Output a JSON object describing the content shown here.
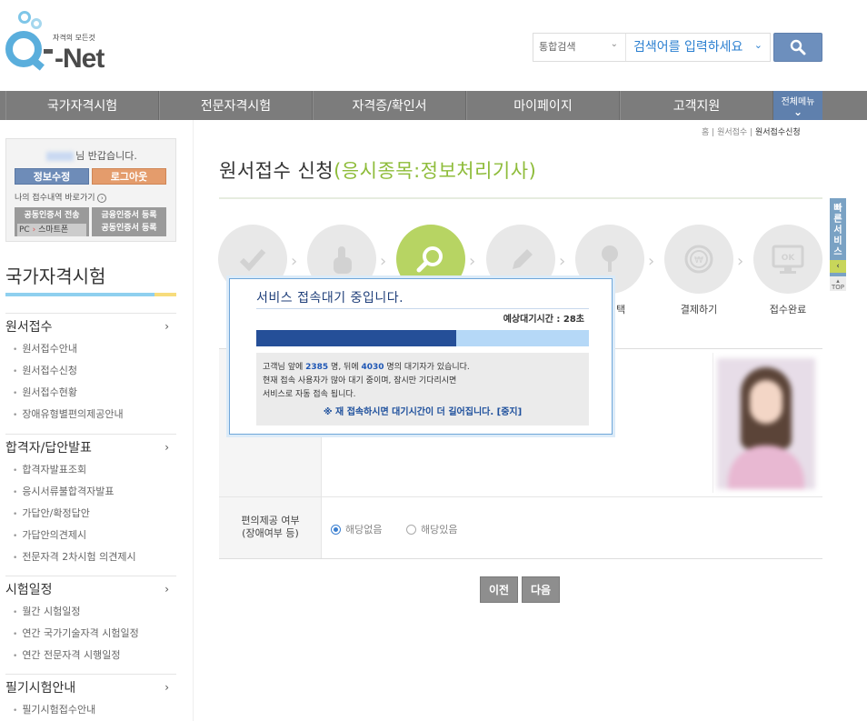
{
  "header": {
    "logo_text": "-Net",
    "logo_tagline": "자격의 모든것",
    "search_category": "통합검색",
    "search_placeholder": "검색어를 입력하세요"
  },
  "nav": {
    "items": [
      "국가자격시험",
      "전문자격시험",
      "자격증/확인서",
      "마이페이지",
      "고객지원"
    ],
    "all_menu": "전체메뉴"
  },
  "login": {
    "greeting": "님 반갑습니다.",
    "edit_label": "정보수정",
    "logout_label": "로그아웃",
    "history_link": "나의 접수내역 바로가기",
    "cert_send_line1": "공동인증서 전송",
    "cert_send_line2": "PC",
    "cert_send_line3": "스마트폰",
    "cert_reg_line1": "금융인증서 등록",
    "cert_reg_line2": "공동인증서 등록"
  },
  "sidebar": {
    "section_title": "국가자격시험",
    "groups": [
      {
        "title": "원서접수",
        "items": [
          "원서접수안내",
          "원서접수신청",
          "원서접수현황",
          "장애유형별편의제공안내"
        ]
      },
      {
        "title": "합격자/답안발표",
        "items": [
          "합격자발표조회",
          "응시서류불합격자발표",
          "가답안/확정답안",
          "가답안의견제시",
          "전문자격 2차시험 의견제시"
        ]
      },
      {
        "title": "시험일정",
        "items": [
          "월간 시험일정",
          "연간 국가기술자격 시험일정",
          "연간 전문자격 시행일정"
        ]
      },
      {
        "title": "필기시험안내",
        "items": [
          "필기시험접수안내"
        ]
      }
    ]
  },
  "breadcrumb": {
    "home": "홈",
    "level1": "원서접수",
    "current": "원서접수신청",
    "sep": "|"
  },
  "page": {
    "title": "원서접수 신청",
    "subject": "(응시종목:정보처리기사)"
  },
  "steps": {
    "labels": [
      "선택",
      "결제하기",
      "접수완료"
    ]
  },
  "form": {
    "option_label_line1": "편의제공 여부",
    "option_label_line2": "(장애여부 등)",
    "radio_no": "해당없음",
    "radio_yes": "해당있음",
    "prev_label": "이전",
    "next_label": "다음"
  },
  "quick": {
    "label": "빠른서비스",
    "top": "TOP"
  },
  "modal": {
    "title": "서비스 접속대기 중입니다.",
    "wait_label": "예상대기시간 : 28초",
    "progress": 0.6,
    "line1_pre": "고객님 앞에 ",
    "ahead": "2385",
    "line1_mid": " 명, 뒤에 ",
    "behind": "4030",
    "line1_post": " 명의 대기자가 있습니다.",
    "line2": "현재 접속 사용자가 많아 대기 중이며, 잠시만 기다리시면",
    "line3": "서비스로 자동 접속 됩니다.",
    "warning": "※ 재 접속하시면 대기시간이 더 길어집니다. [중지]"
  }
}
